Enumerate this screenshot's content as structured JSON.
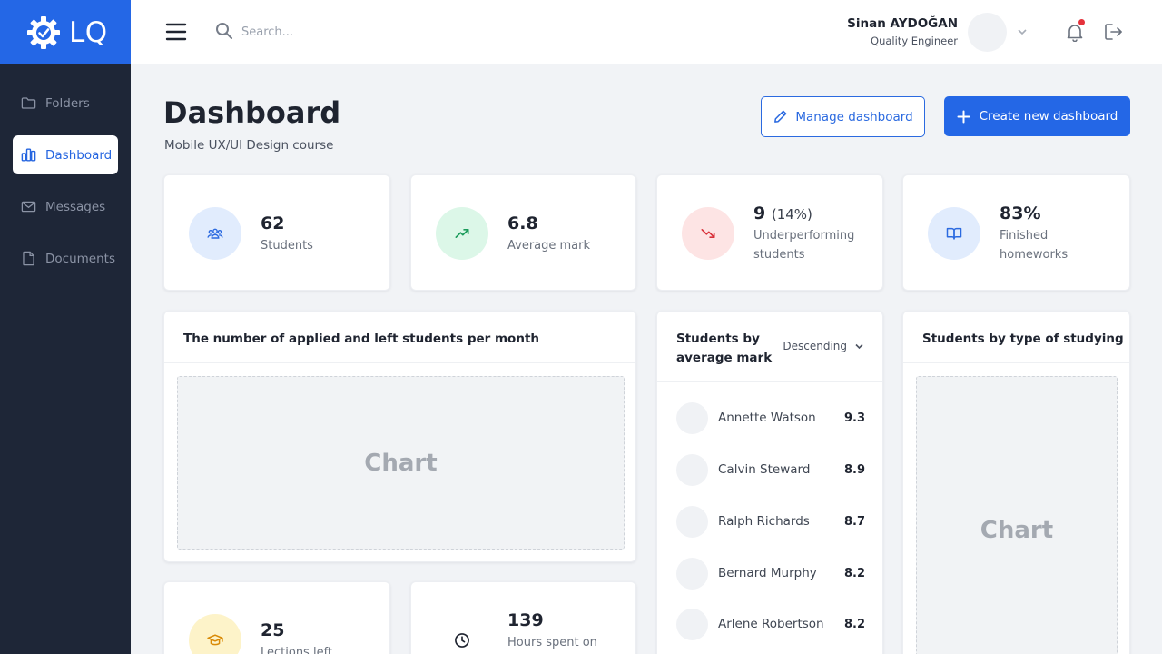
{
  "app": {
    "logo_text": "LQ",
    "accent": "#2467e6",
    "sidebar_bg": "#1e2637"
  },
  "sidebar": {
    "items": [
      {
        "label": "Folders",
        "icon": "folder-icon",
        "active": false
      },
      {
        "label": "Dashboard",
        "icon": "bar-chart-icon",
        "active": true
      },
      {
        "label": "Messages",
        "icon": "mail-icon",
        "active": false
      },
      {
        "label": "Documents",
        "icon": "document-icon",
        "active": false
      }
    ]
  },
  "header": {
    "search": {
      "placeholder": "Search...",
      "value": ""
    },
    "user": {
      "name": "Sinan AYDOĞAN",
      "role": "Quality Engineer"
    },
    "notification_dot_color": "#e5323b"
  },
  "page": {
    "title": "Dashboard",
    "subtitle": "Mobile UX/UI Design course",
    "manage_label": "Manage dashboard",
    "create_label": "Create new dashboard"
  },
  "stats": [
    {
      "value": "62",
      "label": "Students",
      "icon": "users-icon",
      "bg": "#e1ecfd",
      "fg": "#2b6ae0"
    },
    {
      "value": "6.8",
      "label": "Average mark",
      "icon": "trending-up-icon",
      "bg": "#dcf7e8",
      "fg": "#1a9b5a"
    },
    {
      "value": "9",
      "pct": "(14%)",
      "label": "Underperforming students",
      "icon": "trending-down-icon",
      "bg": "#fde4e4",
      "fg": "#d8313a"
    },
    {
      "value": "83%",
      "label": "Finished homeworks",
      "icon": "book-icon",
      "bg": "#e1ecfd",
      "fg": "#2b6ae0"
    }
  ],
  "applied_chart": {
    "title": "The number of applied and left students per month",
    "placeholder": "Chart"
  },
  "ranking": {
    "title": "Students by average mark",
    "sort_label": "Descending",
    "students": [
      {
        "name": "Annette Watson",
        "mark": "9.3"
      },
      {
        "name": "Calvin Steward",
        "mark": "8.9"
      },
      {
        "name": "Ralph Richards",
        "mark": "8.7"
      },
      {
        "name": "Bernard Murphy",
        "mark": "8.2"
      },
      {
        "name": "Arlene Robertson",
        "mark": "8.2"
      }
    ]
  },
  "type_chart": {
    "title": "Students by type of studying",
    "placeholder": "Chart"
  },
  "bottom_stats": [
    {
      "value": "25",
      "label": "Lections left",
      "icon": "graduation-cap-icon",
      "bg": "#fdf3c9",
      "fg": "#d98a06"
    },
    {
      "value": "139",
      "label": "Hours spent on",
      "icon": "clock-icon",
      "bg": "#ffffff",
      "fg": "#1f2430"
    }
  ]
}
